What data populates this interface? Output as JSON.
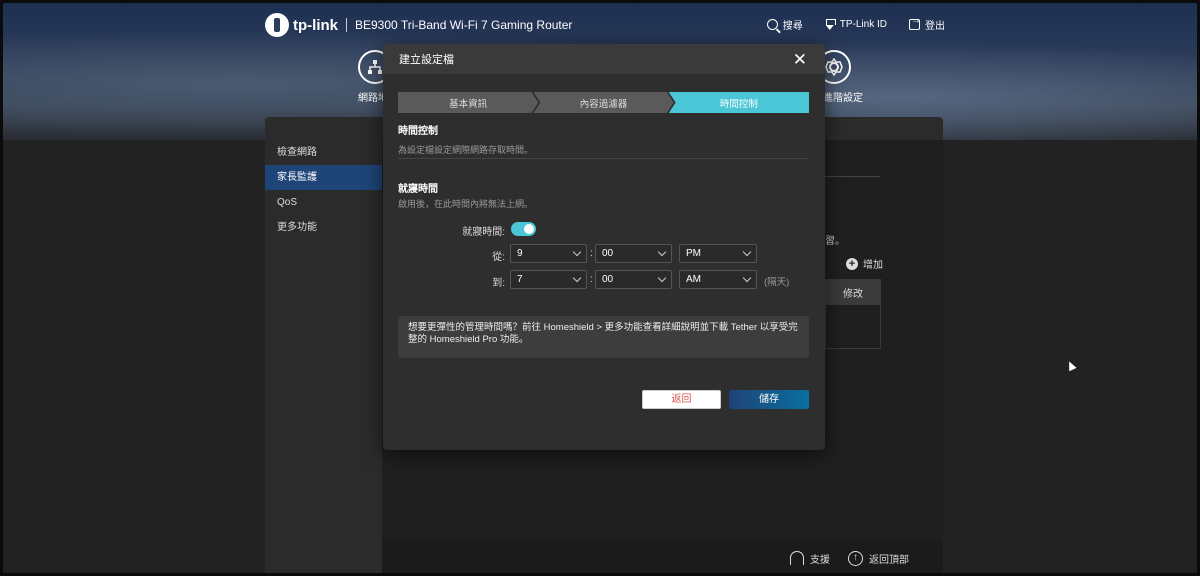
{
  "header": {
    "brand": "tp-link",
    "model": "BE9300 Tri-Band Wi-Fi 7 Gaming Router",
    "actions": [
      {
        "label": "搜尋",
        "icon": "search-icon"
      },
      {
        "label": "TP-Link ID",
        "icon": "tplink-id-icon"
      },
      {
        "label": "登出",
        "icon": "logout-icon"
      }
    ],
    "nav": {
      "network_label": "網路地",
      "settings_label": "進階設定"
    }
  },
  "sidebar": {
    "items": [
      {
        "label": "檢查網路",
        "active": false
      },
      {
        "label": "家長監護",
        "active": true
      },
      {
        "label": "QoS",
        "active": false
      },
      {
        "label": "更多功能",
        "active": false
      }
    ]
  },
  "background": {
    "text_fragment": "習。",
    "add_label": "增加",
    "table_header": "修改"
  },
  "footer": {
    "support_label": "支援",
    "back_to_top_label": "返回頂部"
  },
  "modal": {
    "title": "建立設定檔",
    "steps": [
      {
        "label": "基本資訊",
        "active": false
      },
      {
        "label": "內容過濾器",
        "active": false
      },
      {
        "label": "時間控制",
        "active": true
      }
    ],
    "time_control": {
      "title": "時間控制",
      "description": "為設定檔設定網際網路存取時間。"
    },
    "bedtime": {
      "title": "就寢時間",
      "description": "啟用後，在此時間內將無法上網。",
      "toggle_label": "就寢時間:",
      "enabled": true,
      "from_label": "從:",
      "from": {
        "hour": "9",
        "minute": "00",
        "period": "PM"
      },
      "to_label": "到:",
      "to": {
        "hour": "7",
        "minute": "00",
        "period": "AM"
      },
      "next_day_note": "(隔天)",
      "colon": ":"
    },
    "info_text": "想要更彈性的管理時間嗎？前往 Homeshield > 更多功能查看詳細說明並下載 Tether 以享受完整的 Homeshield Pro 功能。",
    "back_label": "返回",
    "save_label": "儲存"
  }
}
